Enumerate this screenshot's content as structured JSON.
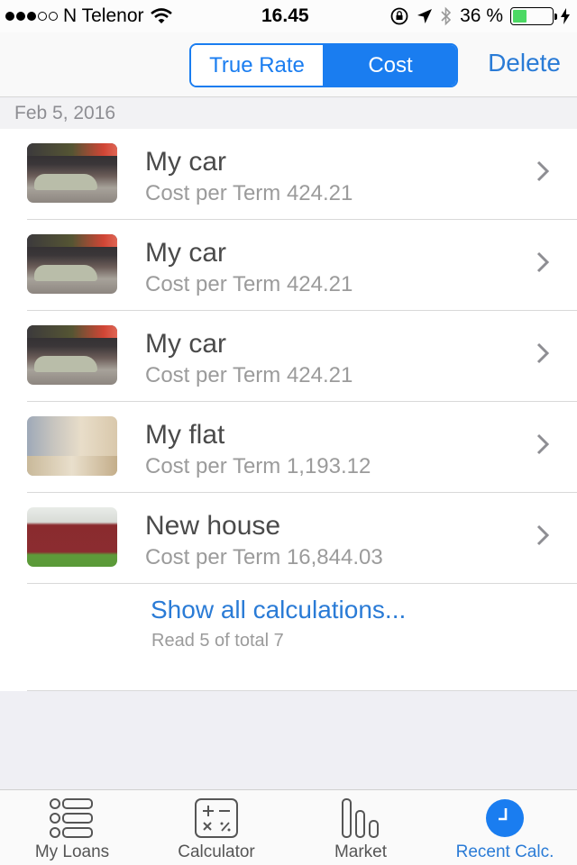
{
  "status_bar": {
    "signal_filled": 3,
    "signal_total": 5,
    "carrier": "N Telenor",
    "time": "16.45",
    "battery_text": "36 %",
    "battery_level": 0.36
  },
  "nav": {
    "segments": [
      {
        "label": "True Rate",
        "active": false
      },
      {
        "label": "Cost",
        "active": true
      }
    ],
    "delete_label": "Delete"
  },
  "section": {
    "date": "Feb 5, 2016"
  },
  "calculations": [
    {
      "title": "My car",
      "subtitle": "Cost per Term 424.21",
      "image": "car"
    },
    {
      "title": "My car",
      "subtitle": "Cost per Term 424.21",
      "image": "car"
    },
    {
      "title": "My car",
      "subtitle": "Cost per Term 424.21",
      "image": "car"
    },
    {
      "title": "My flat",
      "subtitle": "Cost per Term 1,193.12",
      "image": "flat"
    },
    {
      "title": "New house",
      "subtitle": "Cost per Term 16,844.03",
      "image": "house"
    }
  ],
  "footer": {
    "show_all_label": "Show all calculations...",
    "read_count": "Read 5 of total 7"
  },
  "tabs": [
    {
      "label": "My Loans",
      "icon": "list-icon",
      "active": false
    },
    {
      "label": "Calculator",
      "icon": "calculator-icon",
      "active": false
    },
    {
      "label": "Market",
      "icon": "bar-chart-icon",
      "active": false
    },
    {
      "label": "Recent Calc.",
      "icon": "clock-icon",
      "active": true
    }
  ],
  "colors": {
    "accent": "#1a7df0",
    "link": "#2a7bd6",
    "battery": "#4cd964"
  }
}
